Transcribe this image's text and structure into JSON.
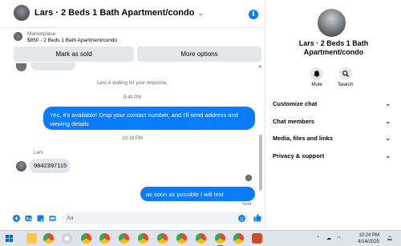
{
  "chat": {
    "header_title": "Lars · 2 Beds 1 Bath Apartment/condo",
    "info_glyph": "i",
    "marketplace_label": "Marketplace",
    "listing_title": "$850 - 2 Beds 1 Bath Apartment/condo",
    "mark_sold_label": "Mark as sold",
    "more_options_label": "More options",
    "waiting_text": "Lars is waiting for your response.",
    "time_1": "9:40 PM",
    "outgoing_1": "Yes, it's available! Drop your contact number, and I'll send address and viewing details",
    "time_2": "10:19 PM",
    "sender_name": "Lars",
    "incoming_1": "9842397115",
    "outgoing_2": "as soon as possible I will text you..Thanks",
    "sent_status": "Sent",
    "input_placeholder": "Aa"
  },
  "right_panel": {
    "title": "Lars · 2 Beds 1 Bath Apartment/condo",
    "mute_label": "Mute",
    "search_label": "Search",
    "rows": [
      {
        "label": "Customize chat"
      },
      {
        "label": "Chat members"
      },
      {
        "label": "Media, files and links"
      },
      {
        "label": "Privacy & support"
      }
    ]
  },
  "taskbar": {
    "time": "10:24 PM",
    "date": "4/14/2025"
  },
  "colors": {
    "accent": "#0a7cff",
    "bubble_in": "#e4e6eb",
    "taskbar": "#dfe3ea"
  }
}
